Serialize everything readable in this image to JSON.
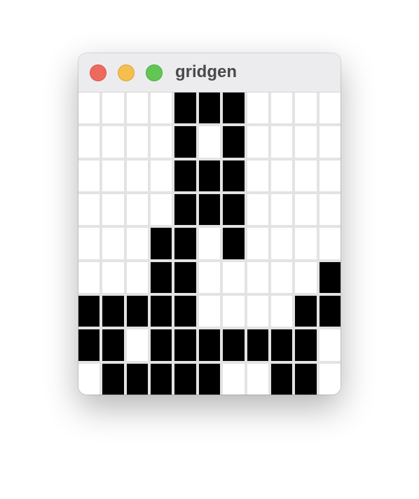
{
  "window": {
    "title": "gridgen",
    "controls": [
      "close",
      "minimize",
      "zoom"
    ],
    "colors": {
      "close": "#ee6a5f",
      "minimize": "#f5be4f",
      "zoom": "#62c554",
      "cell_on": "#000000",
      "cell_off": "#ffffff",
      "grid_line": "#e3e3e3"
    }
  },
  "grid": {
    "rows": 9,
    "cols": 11,
    "cells": [
      [
        0,
        0,
        0,
        0,
        1,
        1,
        1,
        0,
        0,
        0,
        0
      ],
      [
        0,
        0,
        0,
        0,
        1,
        0,
        1,
        0,
        0,
        0,
        0
      ],
      [
        0,
        0,
        0,
        0,
        1,
        1,
        1,
        0,
        0,
        0,
        0
      ],
      [
        0,
        0,
        0,
        0,
        1,
        1,
        1,
        0,
        0,
        0,
        0
      ],
      [
        0,
        0,
        0,
        1,
        1,
        0,
        1,
        0,
        0,
        0,
        0
      ],
      [
        0,
        0,
        0,
        1,
        1,
        0,
        0,
        0,
        0,
        0,
        1
      ],
      [
        1,
        1,
        1,
        1,
        1,
        0,
        0,
        0,
        0,
        1,
        1
      ],
      [
        1,
        1,
        0,
        1,
        1,
        1,
        1,
        1,
        1,
        1,
        0
      ],
      [
        0,
        1,
        1,
        1,
        1,
        1,
        0,
        0,
        1,
        1,
        0
      ]
    ]
  }
}
